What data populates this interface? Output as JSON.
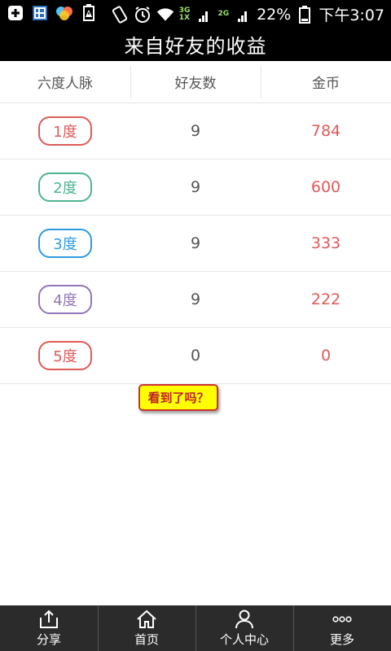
{
  "status_bar": {
    "net_3g": "3G",
    "net_1x": "1X",
    "net_2g": "2G",
    "battery": "22%",
    "time": "下午3:07",
    "icons": [
      "add-square-icon",
      "calendar-icon",
      "colorful-circles-icon",
      "battery-warning-icon",
      "rotate-icon",
      "alarm-icon",
      "wifi-icon",
      "signal-icon",
      "battery-icon"
    ]
  },
  "header": {
    "title": "来自好友的收益"
  },
  "table": {
    "columns": [
      "六度人脉",
      "好友数",
      "金币"
    ],
    "rows": [
      {
        "degree": "1度",
        "friends": "9",
        "coins": "784",
        "color": "#e05a5a"
      },
      {
        "degree": "2度",
        "friends": "9",
        "coins": "600",
        "color": "#4fb394"
      },
      {
        "degree": "3度",
        "friends": "9",
        "coins": "333",
        "color": "#2e9be0"
      },
      {
        "degree": "4度",
        "friends": "9",
        "coins": "222",
        "color": "#9177b8"
      },
      {
        "degree": "5度",
        "friends": "0",
        "coins": "0",
        "color": "#e05a5a"
      }
    ]
  },
  "hint": {
    "text": "看到了吗？"
  },
  "bottom_nav": [
    {
      "label": "分享",
      "icon": "share-icon"
    },
    {
      "label": "首页",
      "icon": "home-icon"
    },
    {
      "label": "个人中心",
      "icon": "user-icon"
    },
    {
      "label": "更多",
      "icon": "more-icon"
    }
  ]
}
